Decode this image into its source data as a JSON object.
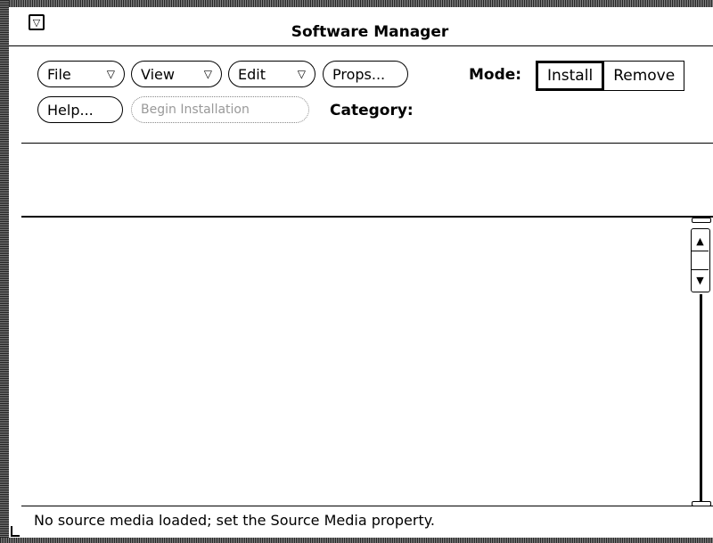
{
  "window": {
    "title": "Software Manager",
    "menu_glyph": "▽"
  },
  "toolbar": {
    "file_label": "File",
    "view_label": "View",
    "edit_label": "Edit",
    "menu_arrow": "▽",
    "props_label": "Props...",
    "help_label": "Help...",
    "begin_label": "Begin Installation"
  },
  "mode": {
    "label": "Mode:",
    "options": [
      "Install",
      "Remove"
    ],
    "selected": "Install"
  },
  "category": {
    "label": "Category:"
  },
  "scrollbar": {
    "up_glyph": "▲",
    "down_glyph": "▼"
  },
  "footer": {
    "status": "No source media loaded; set the Source Media property."
  }
}
